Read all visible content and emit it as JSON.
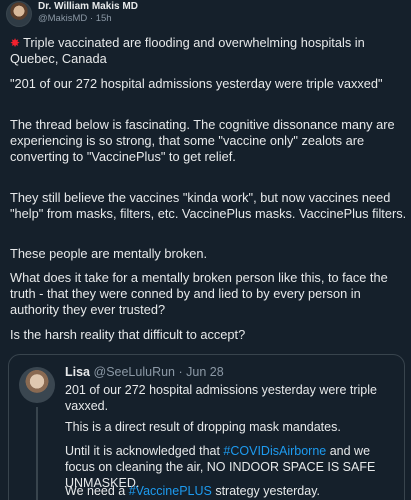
{
  "tweet": {
    "author_name": "Dr. William Makis MD",
    "author_handle": "@MakisMD",
    "separator": "·",
    "time": "15h",
    "line1": "Triple vaccinated are flooding and overwhelming hospitals in Quebec, Canada",
    "line2": "\"201 of our 272 hospital admissions yesterday were triple vaxxed\"",
    "line3": "The thread below is fascinating. The cognitive dissonance many are experiencing is so strong, that some \"vaccine only\" zealots are converting to \"VaccinePlus\" to get relief.",
    "line4": "They still believe the vaccines \"kinda work\", but now vaccines need \"help\" from masks, filters, etc. VaccinePlus masks. VaccinePlus filters.",
    "line5": "These people are mentally broken.",
    "line6": "What does it take for a mentally broken person like this, to face the truth - that they were conned by and lied to by every person in authority they ever trusted?",
    "line7": "Is the harsh reality that difficult to accept?"
  },
  "quoted": {
    "author_name": "Lisa",
    "author_handle": "@SeeLuluRun",
    "separator": "·",
    "date": "Jun 28",
    "text1": "201 of our 272 hospital admissions yesterday were triple vaxxed.",
    "text2": "This is a direct result of dropping mask mandates.",
    "text3_before": "Until it is acknowledged that ",
    "text3_link": "#COVIDisAirborne",
    "text3_after": " and we focus on cleaning the air, NO INDOOR SPACE IS SAFE UNMASKED.",
    "text4_before": "We need a ",
    "text4_link": "#VaccinePLUS",
    "text4_after": " strategy yesterday."
  },
  "colors": {
    "background": "#15202b",
    "text": "#e7e9ea",
    "secondary_text": "#8b98a5",
    "link": "#1d9bf0",
    "border": "#38444d",
    "emoji_red": "#f4212e"
  },
  "icons": {
    "collision": "collision-emoji-icon"
  }
}
